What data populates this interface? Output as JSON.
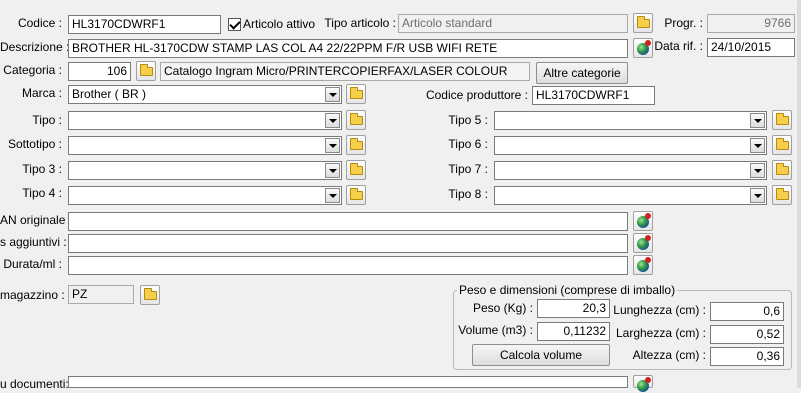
{
  "header": {
    "codice_label": "Codice :",
    "codice_value": "HL3170CDWRF1",
    "articolo_attivo_label": "Articolo attivo",
    "tipo_articolo_label": "Tipo articolo :",
    "tipo_articolo_placeholder": "Articolo standard",
    "progr_label": "Progr. :",
    "progr_value": "9766",
    "descrizione_label": "Descrizione :",
    "descrizione_value": "BROTHER HL-3170CDW STAMP LAS COL A4 22/22PPM F/R USB WIFI RETE",
    "data_rif_label": "Data rif. :",
    "data_rif_value": "24/10/2015",
    "categoria_label": "Categoria :",
    "categoria_code": "106",
    "categoria_desc": "Catalogo Ingram Micro/PRINTERCOPIERFAX/LASER COLOUR",
    "altre_categorie_button": "Altre categorie"
  },
  "classification": {
    "marca_label": "Marca :",
    "marca_value": "Brother ( BR )",
    "codice_produttore_label": "Codice produttore :",
    "codice_produttore_value": "HL3170CDWRF1",
    "tipo_label": "Tipo :",
    "sottotipo_label": "Sottotipo :",
    "tipo3_label": "Tipo 3 :",
    "tipo4_label": "Tipo 4 :",
    "tipo5_label": "Tipo 5 :",
    "tipo6_label": "Tipo 6 :",
    "tipo7_label": "Tipo 7 :",
    "tipo8_label": "Tipo 8 :"
  },
  "extra": {
    "ean_label": "AN originale :",
    "aggiuntivi_label": "s aggiuntivi :",
    "durata_label": "Durata/ml :",
    "magazzino_label": "magazzino :",
    "magazzino_value": "PZ",
    "documenti_label": "u documenti:"
  },
  "peso": {
    "title": "Peso e dimensioni (comprese di imballo)",
    "peso_label": "Peso (Kg) :",
    "peso_value": "20,3",
    "volume_label": "Volume (m3) :",
    "volume_value": "0,11232",
    "calcola_button": "Calcola volume",
    "lunghezza_label": "Lunghezza (cm) :",
    "lunghezza_value": "0,6",
    "larghezza_label": "Larghezza (cm) :",
    "larghezza_value": "0,52",
    "altezza_label": "Altezza (cm) :",
    "altezza_value": "0,36"
  }
}
